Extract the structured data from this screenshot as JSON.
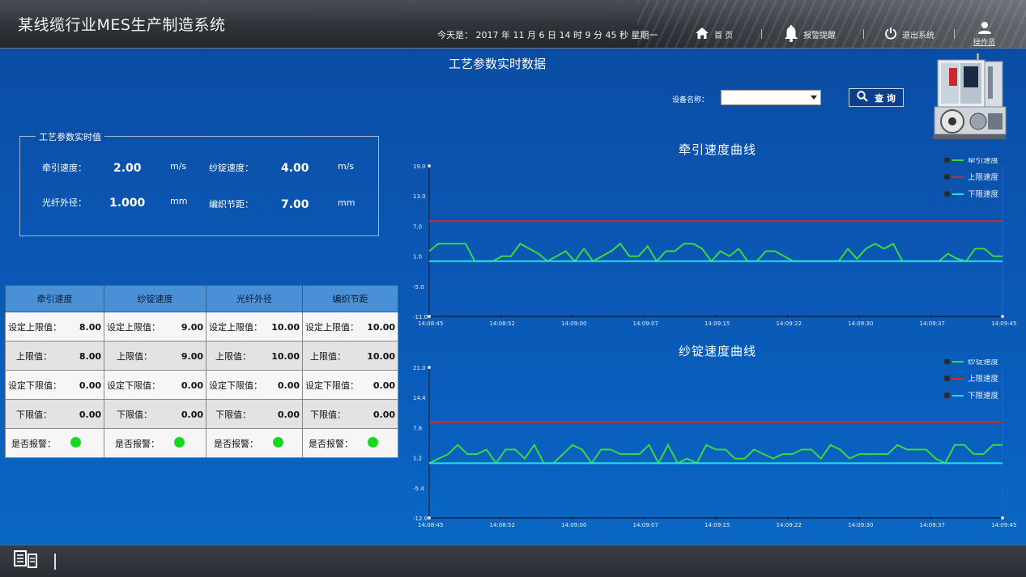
{
  "app": {
    "title": "某线缆行业MES生产制造系统",
    "datetime": "今天是： 2017 年 11 月 6 日  14 时 9 分 45 秒    星期一"
  },
  "nav": {
    "home": "首 页",
    "alarm": "报警提醒",
    "exit": "退出系统",
    "user": "操作员"
  },
  "page": {
    "title": "工艺参数实时数据",
    "device_label": "设备名称：",
    "device_value": "",
    "query_label": "查 询"
  },
  "realtime": {
    "legend": "工艺参数实时值",
    "items": [
      {
        "label": "牵引速度：",
        "value": "2.00",
        "unit": "m/s"
      },
      {
        "label": "纱锭速度：",
        "value": "4.00",
        "unit": "m/s"
      },
      {
        "label": "光纤外径：",
        "value": "1.000",
        "unit": "mm"
      },
      {
        "label": "编织节距：",
        "value": "7.00",
        "unit": "mm"
      }
    ]
  },
  "table": {
    "headers": [
      "牵引速度",
      "纱锭速度",
      "光纤外径",
      "编织节距"
    ],
    "rows": [
      {
        "labels": [
          "设定上限值：",
          "设定上限值：",
          "设定上限值：",
          "设定上限值："
        ],
        "values": [
          "8.00",
          "9.00",
          "10.00",
          "10.00"
        ]
      },
      {
        "labels": [
          "上限值：",
          "上限值：",
          "上限值：",
          "上限值："
        ],
        "values": [
          "8.00",
          "9.00",
          "10.00",
          "10.00"
        ]
      },
      {
        "labels": [
          "设定下限值：",
          "设定下限值：",
          "设定下限值：",
          "设定下限值："
        ],
        "values": [
          "0.00",
          "0.00",
          "0.00",
          "0.00"
        ]
      },
      {
        "labels": [
          "下限值：",
          "下限值：",
          "下限值：",
          "下限值："
        ],
        "values": [
          "0.00",
          "0.00",
          "0.00",
          "0.00"
        ]
      }
    ],
    "alarm_label": "是否报警：",
    "alarm_color": "#19d61e"
  },
  "chart_data": [
    {
      "type": "line",
      "title": "牵引速度曲线",
      "xlabel": "",
      "ylabel": "",
      "ylim": [
        -11.0,
        19.0
      ],
      "y_ticks": [
        "19.0",
        "13.0",
        "7.0",
        "1.0",
        "-5.0",
        "-11.0"
      ],
      "x_ticks": [
        "14:08:45",
        "14:08:52",
        "14:09:00",
        "14:09:07",
        "14:09:15",
        "14:09:22",
        "14:09:30",
        "14:09:37",
        "14:09:45"
      ],
      "legend_position": "top-right",
      "series": [
        {
          "name": "牵引速度",
          "color": "#3bd93b",
          "values": [
            2.0,
            3.5,
            3.5,
            3.5,
            3.5,
            0.0,
            0.0,
            0.0,
            1.0,
            1.0,
            3.5,
            2.5,
            1.5,
            0.0,
            1.0,
            2.0,
            0.0,
            2.5,
            0.0,
            1.0,
            2.0,
            3.5,
            1.0,
            1.0,
            3.0,
            0.0,
            2.0,
            2.0,
            3.5,
            3.5,
            2.5,
            0.0,
            2.0,
            1.0,
            2.5,
            0.0,
            0.0,
            2.0,
            2.0,
            1.0,
            0.0,
            0.0,
            0.0,
            0.0,
            0.0,
            0.0,
            2.5,
            0.5,
            2.5,
            3.5,
            2.5,
            3.5,
            0.0,
            0.0,
            0.0,
            0.0,
            0.0,
            1.5,
            0.5,
            0.0,
            2.5,
            2.5,
            1.0,
            1.0
          ]
        },
        {
          "name": "上限速度",
          "color": "#d02a2a",
          "values": [
            8.0
          ]
        },
        {
          "name": "下限速度",
          "color": "#18e4f0",
          "values": [
            0.0
          ]
        }
      ]
    },
    {
      "type": "line",
      "title": "纱锭速度曲线",
      "xlabel": "",
      "ylabel": "",
      "ylim": [
        -12.0,
        21.0
      ],
      "y_ticks": [
        "21.0",
        "14.4",
        "7.8",
        "1.2",
        "-5.4",
        "-12.0"
      ],
      "x_ticks": [
        "14:08:45",
        "14:08:52",
        "14:09:00",
        "14:09:07",
        "14:09:15",
        "14:09:22",
        "14:09:30",
        "14:09:37",
        "14:09:45"
      ],
      "legend_position": "top-right",
      "series": [
        {
          "name": "纱锭速度",
          "color": "#3bd93b",
          "values": [
            0.0,
            1.0,
            2.0,
            4.0,
            2.0,
            2.0,
            3.0,
            0.0,
            3.0,
            3.0,
            1.0,
            4.0,
            0.0,
            0.0,
            2.0,
            4.0,
            3.0,
            0.0,
            3.0,
            3.0,
            2.0,
            2.0,
            2.0,
            4.0,
            0.0,
            4.0,
            0.0,
            1.0,
            0.0,
            4.0,
            3.0,
            3.0,
            1.0,
            1.0,
            3.0,
            2.0,
            1.0,
            2.0,
            2.0,
            3.0,
            3.0,
            1.0,
            4.0,
            3.0,
            1.0,
            2.0,
            2.0,
            2.0,
            2.0,
            4.0,
            3.0,
            3.0,
            3.0,
            1.0,
            0.0,
            4.0,
            4.0,
            2.0,
            2.0,
            4.0,
            4.0
          ]
        },
        {
          "name": "上限速度",
          "color": "#d02a2a",
          "values": [
            9.0
          ]
        },
        {
          "name": "下限速度",
          "color": "#18e4f0",
          "values": [
            0.0
          ]
        }
      ]
    }
  ]
}
